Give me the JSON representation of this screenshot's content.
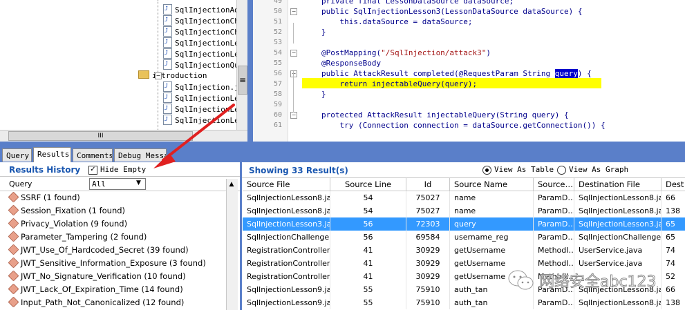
{
  "tree": {
    "items": [
      {
        "label": "SqlInjectionAdv"
      },
      {
        "label": "SqlInjectionChe"
      },
      {
        "label": "SqlInjectionChe"
      },
      {
        "label": "SqlInjectionLes"
      },
      {
        "label": "SqlInjectionLes"
      },
      {
        "label": "SqlInjectionQui"
      },
      {
        "label": "introduction",
        "folder": true
      },
      {
        "label": "SqlInjection.ja"
      },
      {
        "label": "SqlInjectionLes"
      },
      {
        "label": "SqlInjectionLes"
      },
      {
        "label": "SqlInjectionLes"
      }
    ],
    "scroll_glyph": "III",
    "menu_glyph": "≡"
  },
  "code": {
    "lines": [
      {
        "num": "49",
        "text": "private final LessonDataSource dataSource;"
      },
      {
        "num": "50",
        "text": "public SqlInjectionLesson3(LessonDataSource dataSource) {"
      },
      {
        "num": "51",
        "text": "    this.dataSource = dataSource;"
      },
      {
        "num": "52",
        "text": "}"
      },
      {
        "num": "53",
        "text": ""
      },
      {
        "num": "54",
        "text_pre": "@PostMapping(",
        "text_str": "\"/SqlInjection/attack3\"",
        "text_post": ")"
      },
      {
        "num": "55",
        "text": "@ResponseBody"
      },
      {
        "num": "56",
        "text_pre": "public AttackResult completed(@RequestParam String ",
        "text_sel": "query",
        "text_post": ") {"
      },
      {
        "num": "57",
        "text": "    return injectableQuery(query);"
      },
      {
        "num": "58",
        "text": "}"
      },
      {
        "num": "59",
        "text": ""
      },
      {
        "num": "60",
        "text": "protected AttackResult injectableQuery(String query) {"
      },
      {
        "num": "61",
        "text": "    try (Connection connection = dataSource.getConnection()) {"
      }
    ]
  },
  "tabs": [
    {
      "label": "Query"
    },
    {
      "label": "Results"
    },
    {
      "label": "Comments"
    },
    {
      "label": "Debug Messa"
    }
  ],
  "results_history": {
    "title": "Results History",
    "hide_empty_label": "Hide Empty",
    "hide_empty_checked": true,
    "check_glyph": "✓",
    "query_label": "Query",
    "query_filter": "All",
    "dropdown_glyph": "▼",
    "scroll_glyph": "▲",
    "items": [
      {
        "label": "SSRF (1 found)"
      },
      {
        "label": "Session_Fixation (1 found)"
      },
      {
        "label": "Privacy_Violation (9 found)"
      },
      {
        "label": "Parameter_Tampering (2 found)"
      },
      {
        "label": "JWT_Use_Of_Hardcoded_Secret (39 found)"
      },
      {
        "label": "JWT_Sensitive_Information_Exposure (3 found)"
      },
      {
        "label": "JWT_No_Signature_Verification (10 found)"
      },
      {
        "label": "JWT_Lack_Of_Expiration_Time (14 found)"
      },
      {
        "label": "Input_Path_Not_Canonicalized (12 found)"
      }
    ]
  },
  "results_table": {
    "title": "Showing 33 Result(s)",
    "view_table_label": "View As Table",
    "view_graph_label": "View As Graph",
    "view_mode": "table",
    "columns": [
      "Source File",
      "Source Line",
      "Id",
      "Source Name",
      "Source…",
      "Destination File",
      "Dest"
    ],
    "rows": [
      [
        "SqlInjectionLesson8.ja…",
        "54",
        "75027",
        "name",
        "ParamD…",
        "SqlInjectionLesson8.ja…",
        "66"
      ],
      [
        "SqlInjectionLesson8.ja…",
        "54",
        "75027",
        "name",
        "ParamD…",
        "SqlInjectionLesson8.ja…",
        "138"
      ],
      [
        "SqlInjectionLesson3.ja…",
        "56",
        "72303",
        "query",
        "ParamD…",
        "SqlInjectionLesson3.ja…",
        "65"
      ],
      [
        "SqlInjectionChallenge.…",
        "56",
        "69584",
        "username_reg",
        "ParamD…",
        "SqlInjectionChallenge.…",
        "65"
      ],
      [
        "RegistrationController.j…",
        "41",
        "30929",
        "getUsername",
        "MethodI…",
        "UserService.java",
        "74"
      ],
      [
        "RegistrationController.j…",
        "41",
        "30929",
        "getUsername",
        "MethodI…",
        "UserService.java",
        "74"
      ],
      [
        "RegistrationController.j…",
        "41",
        "30929",
        "getUsername",
        "MethodI…",
        "",
        "52"
      ],
      [
        "SqlInjectionLesson9.ja…",
        "55",
        "75910",
        "auth_tan",
        "ParamD…",
        "SqlInjectionLesson8.ja…",
        "66"
      ],
      [
        "SqlInjectionLesson9.ja…",
        "55",
        "75910",
        "auth_tan",
        "ParamD…",
        "SqlInjectionLesson8.ja…",
        "138"
      ]
    ],
    "selected_row": 2
  },
  "watermark": {
    "text": "网络安全abc123"
  },
  "colors": {
    "accent": "#5a7fc9",
    "selection": "#3399ff",
    "highlight": "#ffff00",
    "heading": "#1a57b0",
    "arrow": "#e02020"
  }
}
